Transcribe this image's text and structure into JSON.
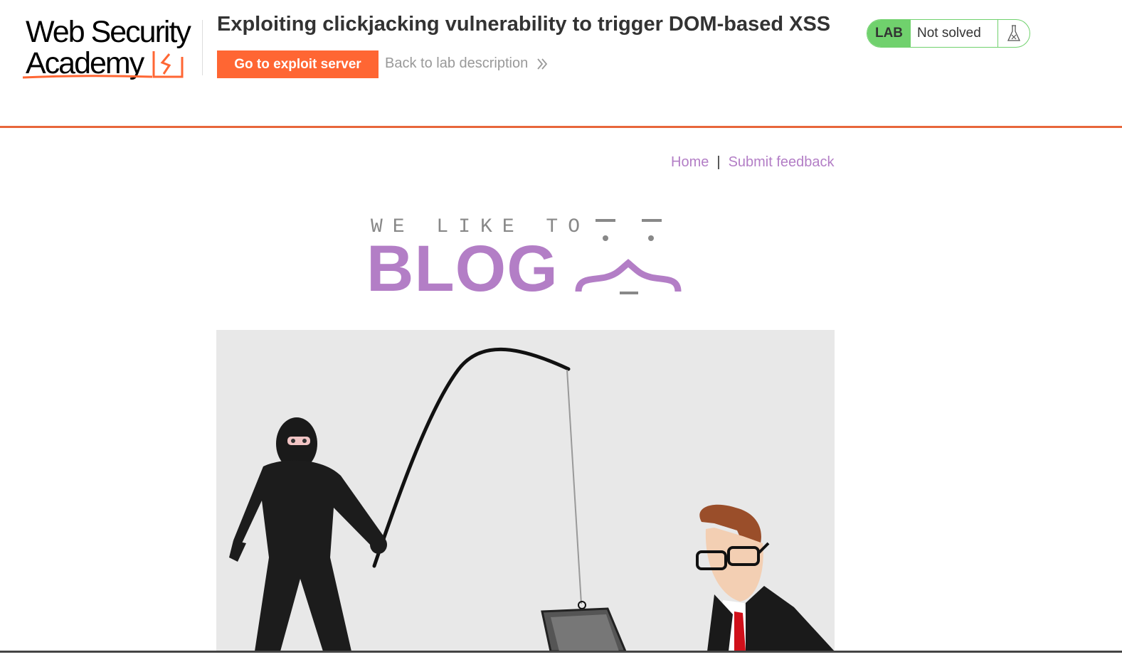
{
  "academy": {
    "logo_line1": "Web Security",
    "logo_line2": "Academy",
    "lab_title": "Exploiting clickjacking vulnerability to trigger DOM-based XSS",
    "exploit_button": "Go to exploit server",
    "back_link": "Back to lab description",
    "lab_badge": "LAB",
    "lab_status": "Not solved",
    "colors": {
      "accent": "#ff6633",
      "rule": "#e8663b",
      "solved_green": "#70d16d"
    },
    "icons": {
      "back": "double-chevron-right-icon",
      "status": "flask-icon"
    }
  },
  "nav": {
    "home": "Home",
    "separator": "|",
    "feedback": "Submit feedback",
    "link_color": "#b37ec6"
  },
  "banner": {
    "tagline": "WE LIKE TO",
    "title": "BLOG"
  },
  "hero": {
    "image": "phishing-illustration",
    "figures": [
      "hooded-thief-with-fishing-rod",
      "businessman-with-laptop"
    ]
  }
}
